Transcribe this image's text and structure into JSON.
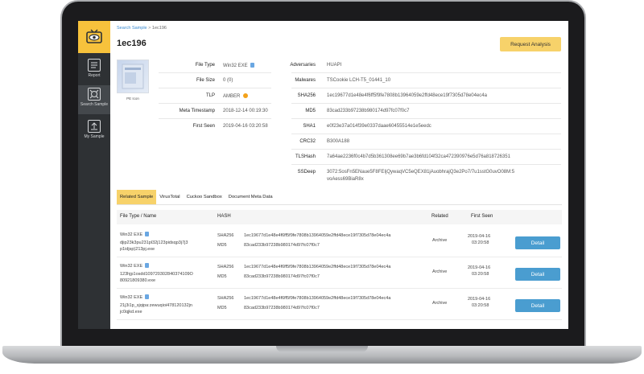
{
  "breadcrumb": {
    "root": "Search Sample",
    "separator": " > ",
    "current": "1ec196"
  },
  "title": "1ec196",
  "request_button": "Request Analysis",
  "sidebar": {
    "items": [
      {
        "label": "Report",
        "icon": "report-icon"
      },
      {
        "label": "Search Sample",
        "icon": "search-sample-icon"
      },
      {
        "label": "My Sample",
        "icon": "upload-icon"
      }
    ]
  },
  "thumbnail_caption": "PE Icon",
  "file_info": {
    "file_type_label": "File Type",
    "file_type": "Win32 EXE",
    "file_size_label": "File Size",
    "file_size": "0 (0)",
    "tlp_label": "TLP",
    "tlp": "AMBER",
    "meta_ts_label": "Meta Timestamp",
    "meta_ts": "2018-12-14 00:19:30",
    "first_seen_label": "First Seen",
    "first_seen": "2019-04-16 03:20:58"
  },
  "hashes": {
    "adversaries_label": "Adversaries",
    "adversaries": "HUAPI",
    "malwares_label": "Malwares",
    "malwares": "TSCookie LCH-T5_01441_10",
    "sha256_label": "SHA256",
    "sha256": "1ec19677d1e48e4f6ff5f9fe7808b13964059e2ffd48ece19f7305d78e04ec4a",
    "md5_label": "MD5",
    "md5": "83cad233b97238b980174d97fc07f0c7",
    "sha1_label": "SHA1",
    "sha1": "e0f23e37a014f39e0337daae60455514e1e5eedc",
    "crc32_label": "CRC32",
    "crc32": "B300A188",
    "tlshash_label": "TLSHash",
    "tlshash": "7a64ae2236f0c4b7d5b361308ee69b7ae3b6fd104f32ca472390976e5d76a818726351",
    "ssdeep_label": "SSDeep",
    "ssdeep_1": "3072:5osFn5ENaue5F8FEIjQywaqVC5eQEX81jAuobhrajQ3e2Po7/7u1sstG0uvO08M:5",
    "ssdeep_2": "voAess69BiaR8x"
  },
  "tabs": [
    "Related Sample",
    "VirusTotal",
    "Cuckoo Sandbox",
    "Document Meta Data"
  ],
  "table": {
    "headers": {
      "file": "File Type / Name",
      "hash": "HASH",
      "related": "Related",
      "first_seen": "First Seen"
    },
    "rows": [
      {
        "type": "Win32 EXE",
        "name1": "djip23k3pu231pl32j123pidsqp3j7j3",
        "name2": "p1idjsp)213pj.exe",
        "sha_label": "SHA256",
        "sha": "1ec19677d1e48e4f6ff5f9fe7808b13964059e2ffd48ece19f7305d78e04ec4a",
        "md5_label": "MD5",
        "md5": "83cad233b97238b980174d97fc07f0c7",
        "related": "Archive",
        "date": "2019-04-16",
        "time": "03:20:58",
        "button": "Detail"
      },
      {
        "type": "Win32 EXE",
        "name1": "123hjp1osdd109720302840374109O",
        "name2": "80921809380.exe",
        "sha_label": "SHA256",
        "sha": "1ec19677d1e48e4f6ff5f9fe7808b13964059e2ffd48ece19f7305d78e04ec4a",
        "md5_label": "MD5",
        "md5": "83cad233b97238b980174d97fc07f0c7",
        "related": "Archive",
        "date": "2019-04-16",
        "time": "03:20:58",
        "button": "Detail"
      },
      {
        "type": "Win32 EXE",
        "name1": "21j3i1p_sjqipa:zewuqioi478120132jn",
        "name2": "jc0qjkd.exe",
        "sha_label": "SHA256",
        "sha": "1ec19677d1e48e4f6ff5f9fe7808b13964059e2ffd48ece19f7305d78e04ec4a",
        "md5_label": "MD5",
        "md5": "83cad233b97238b980174d97fc07f0c7",
        "related": "Archive",
        "date": "2019-04-16",
        "time": "03:20:58",
        "button": "Detail"
      }
    ]
  }
}
